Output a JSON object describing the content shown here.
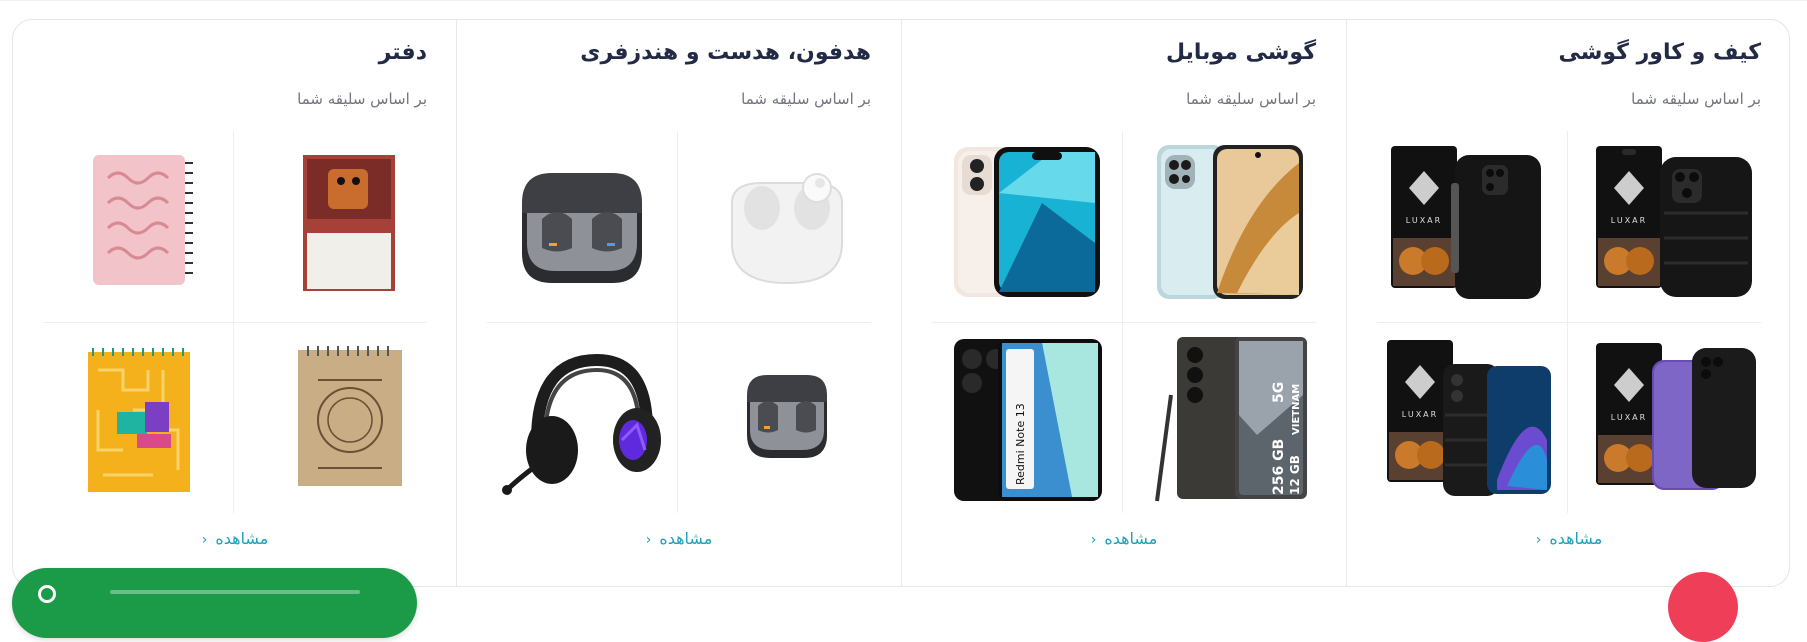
{
  "colors": {
    "accent_link": "#1aa3b9",
    "title": "#232a45",
    "chat_green": "#1b9b48",
    "fab_red": "#ef3e58"
  },
  "categories": [
    {
      "title": "کیف و کاور گوشی",
      "subtitle": "بر اساس سلیقه شما",
      "link": "مشاهده",
      "items": [
        "phone-case-luxar-1",
        "phone-case-luxar-2",
        "phone-case-luxar-3",
        "phone-case-luxar-4"
      ]
    },
    {
      "title": "گوشی موبایل",
      "subtitle": "بر اساس سلیقه شما",
      "link": "مشاهده",
      "items": [
        "phone-gold-back",
        "iphone-13",
        "galaxy-s24-ultra",
        "redmi-note-13"
      ],
      "labels": {
        "galaxy_box": [
          "256 GB",
          "5G",
          "12 GB",
          "VIETNAM"
        ],
        "redmi_box": "Redmi Note 13"
      }
    },
    {
      "title": "هدفون، هدست و هندزفری",
      "subtitle": "بر اساس سلیقه شما",
      "link": "مشاهده",
      "items": [
        "earbuds-white",
        "galaxy-buds-case",
        "galaxy-buds-case-small",
        "gaming-headset"
      ]
    },
    {
      "title": "دفتر",
      "subtitle": "بر اساس سلیقه شما",
      "link": "مشاهده",
      "items": [
        "notebook-brown",
        "notebook-pink-calligraphy",
        "notebook-kraft",
        "notebook-yellow-maze"
      ]
    }
  ],
  "icons": {
    "chevron": "chevron-left-icon",
    "chat": "chat-icon"
  }
}
